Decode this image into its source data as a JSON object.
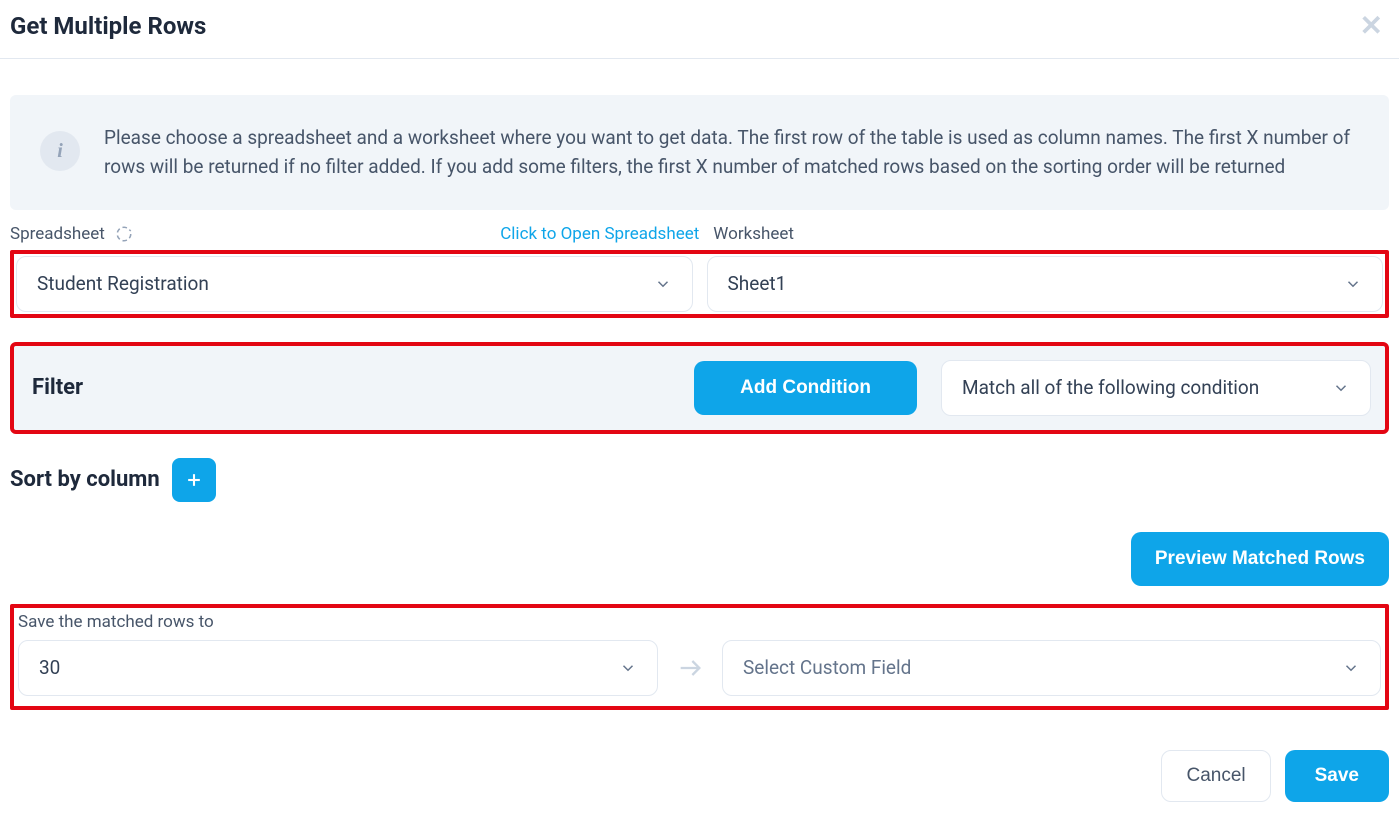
{
  "header": {
    "title": "Get Multiple Rows"
  },
  "info": {
    "text": "Please choose a spreadsheet and a worksheet where you want to get data. The first row of the table is used as column names. The first X number of rows will be returned if no filter added. If you add some filters, the first X number of matched rows based on the sorting order will be returned"
  },
  "labels": {
    "spreadsheet": "Spreadsheet",
    "open_link": "Click to Open Spreadsheet",
    "worksheet": "Worksheet"
  },
  "selects": {
    "spreadsheet": "Student Registration",
    "worksheet": "Sheet1"
  },
  "filter": {
    "label": "Filter",
    "add_button": "Add Condition",
    "match_select": "Match all of the following condition"
  },
  "sort": {
    "label": "Sort by column"
  },
  "preview": {
    "button": "Preview Matched Rows"
  },
  "save_matched": {
    "label": "Save the matched rows to",
    "count": "30",
    "custom_field_placeholder": "Select Custom Field"
  },
  "footer": {
    "cancel": "Cancel",
    "save": "Save"
  }
}
